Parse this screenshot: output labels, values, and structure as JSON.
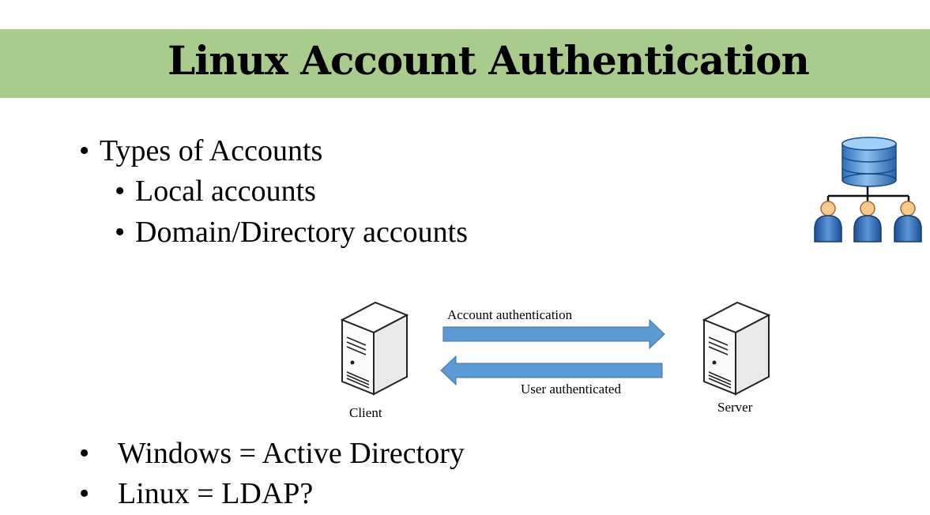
{
  "title": "Linux Account Authentication",
  "bullets_top": {
    "main": "Types of Accounts",
    "sub": [
      "Local accounts",
      "Domain/Directory accounts"
    ]
  },
  "diagram": {
    "client_label": "Client",
    "server_label": "Server",
    "arrow_top_label": "Account authentication",
    "arrow_bottom_label": "User authenticated",
    "arrow_color": "#5b9bd5"
  },
  "bullets_bottom": [
    "Windows = Active Directory",
    "Linux = LDAP?"
  ],
  "bullet_char": "•",
  "colors": {
    "title_band": "#a9cc8d"
  },
  "icons": [
    "server-icon",
    "database-network-icon",
    "user-icon"
  ]
}
